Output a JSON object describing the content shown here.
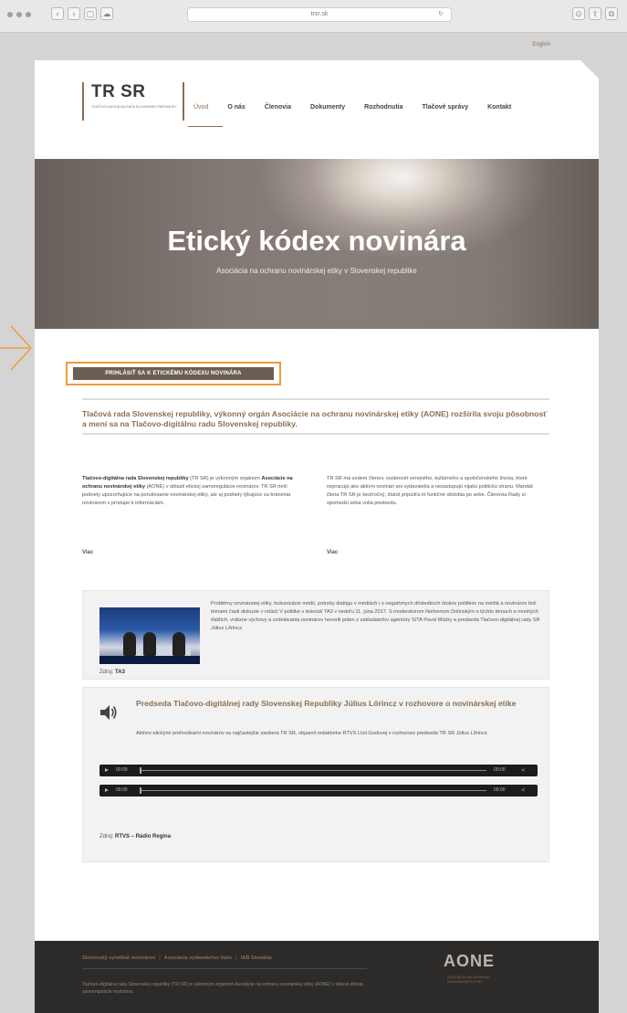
{
  "browser": {
    "url": "trsr.sk",
    "nav_icons": [
      "back-icon",
      "forward-icon",
      "sidebar-icon",
      "cloud-icon"
    ],
    "right_icons": [
      "download-icon",
      "share-icon",
      "tabs-icon"
    ]
  },
  "header": {
    "language_link": "English",
    "logo_title": "TR SR",
    "logo_subtitle": "Tlačovo-digitálna rada Slovenskej republiky",
    "nav": [
      {
        "label": "Úvod",
        "active": true
      },
      {
        "label": "O nás",
        "active": false
      },
      {
        "label": "Členovia",
        "active": false
      },
      {
        "label": "Dokumenty",
        "active": false
      },
      {
        "label": "Rozhodnutia",
        "active": false
      },
      {
        "label": "Tlačové správy",
        "active": false
      },
      {
        "label": "Kontakt",
        "active": false
      }
    ]
  },
  "hero": {
    "title": "Etický kódex novinára",
    "subtitle": "Asociácia na ochranu novinárskej etiky v Slovenskej republike"
  },
  "cta": {
    "label": "PRIHLÁSIŤ SA K ETICKÉMU KÓDEXU NOVINÁRA"
  },
  "lead": {
    "text": "Tlačová rada Slovenskej republiky, výkonný orgán Asociácie na ochranu novinárskej etiky (AONE) rozšírila svoju pôsobnosť a mení sa na Tlačovo-digitálnu radu Slovenskej republiky."
  },
  "columns": {
    "left": {
      "strong1": "Tlačovo-digitálna rada Slovenskej republiky",
      "text1": " (TR SR) je výkonným orgánom ",
      "strong2": "Asociácie na ochranu novinárskej etiky",
      "text2": " (AONE) v oblasti etickej samoregulácie novinárov. TR SR rieši podnety upozorňujúce na porušovanie novinárskej etiky, ale aj podnety týkajúce sa bránenia novinárom v prístupe k informáciám.",
      "more": "Viac"
    },
    "right": {
      "text": "TR SR má sedem členov, osobností verejného, kultúrneho a spoločenského života, ktoré nepracujú ako aktívni novinári ani vydavatelia a nezastupujú nijakú politickú stranu. Mandát člena TR SR je šesťročný, štatút pripúšťa tri funkčné obdobia po sebe. Členovia Rady si spomedzi seba volia predsedu.",
      "more": "Viac"
    }
  },
  "video": {
    "text": "Problémy novinárskej etiky, bulvarizácie médií, potreby dialógu v médiách i o negatívnych dôsledkoch útokov politikov na médiá a novinárov boli témami časti diskusie v relácii V politike v televízii TA3 v nedeľu 11. júna 2017. S moderátorom Norbertom Dolinským o týchto témach a mnohých ďalších, vrátane výchovy a vzdelávania novinárov hovorili jeden z zakladateľov agentúry SITA Pavol Múdry a predseda Tlačovo-digitálnej rady SR Július Lőrincz.",
    "source_label": "Zdroj: ",
    "source_name": "TA3"
  },
  "audio": {
    "title": "Predseda Tlačovo-digitálnej rady Slovenskej Republiky Július Lőrincz v rozhovore o novinárskej etike",
    "text": "Aktívni etickými prehreškami novinárov sa najčastejšie zaoberá TR SR, objasnil redaktorke RTVS Lívii Godovej v rozhovore predseda TR SR Július Lőrincz.",
    "players": [
      {
        "current": "00:00",
        "duration": "00:00"
      },
      {
        "current": "00:00",
        "duration": "00:00"
      }
    ],
    "source_label": "Zdroj: ",
    "source_name": "RTVS – Rádio Regina"
  },
  "footer": {
    "links": [
      "Slovenský syndikát novinárov",
      "Asociácia vydavateľov tlače",
      "IAB Slovakia"
    ],
    "separator": "|",
    "text": "Tlačovo-digitálna rada Slovenskej republiky (TR SR) je výkonným orgánom Asociácie na ochranu novinárskej etiky (AONE) v oblasti etickej samoregulácie novinárov.",
    "aone_title": "AONE",
    "aone_subtitle": "Asociácia na ochranu novinárskej etiky"
  },
  "colors": {
    "accent": "#8a6e55",
    "cta_bg": "#6b5e55",
    "highlight": "#f29a3a",
    "footer_bg": "#2d2b29"
  }
}
